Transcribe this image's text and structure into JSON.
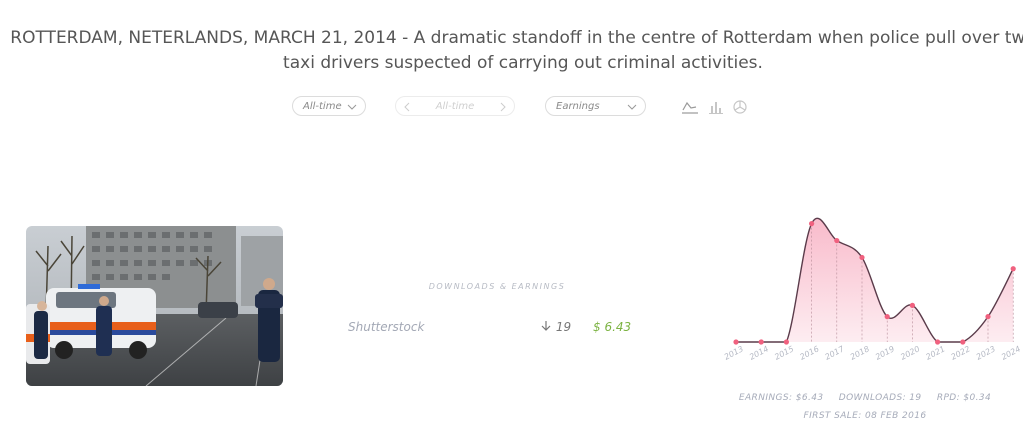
{
  "headline": {
    "line1": "ROTTERDAM, NETERLANDS, MARCH 21, 2014 - A dramatic standoff in the centre of Rotterdam when police pull over two",
    "line2": "taxi drivers suspected of carrying out criminal activities."
  },
  "filters": {
    "period": "All-time",
    "range": "All-time",
    "metric": "Earnings"
  },
  "chart_type_icons": [
    "line-chart-icon",
    "bar-chart-icon",
    "pie-chart-icon"
  ],
  "downloads_section": {
    "header": "DOWNLOADS & EARNINGS",
    "rows": [
      {
        "agency": "Shutterstock",
        "downloads": "19",
        "earnings": "$ 6.43"
      }
    ]
  },
  "chart_data": {
    "type": "area",
    "x": [
      "2013",
      "2014",
      "2015",
      "2016",
      "2017",
      "2018",
      "2019",
      "2020",
      "2021",
      "2022",
      "2023",
      "2024"
    ],
    "values": [
      0,
      0,
      0,
      2.1,
      1.8,
      1.5,
      0.45,
      0.65,
      0,
      0,
      0.45,
      1.3
    ],
    "ylim": [
      0,
      2.2
    ],
    "fill_color": "#f8b7c8",
    "line_color": "#5a3b4a",
    "point_color": "#f0617f"
  },
  "summary": {
    "earnings": "EARNINGS: $6.43",
    "downloads": "DOWNLOADS: 19",
    "rpd": "RPD: $0.34",
    "first_sale": "FIRST SALE: 08 FEB 2016"
  }
}
